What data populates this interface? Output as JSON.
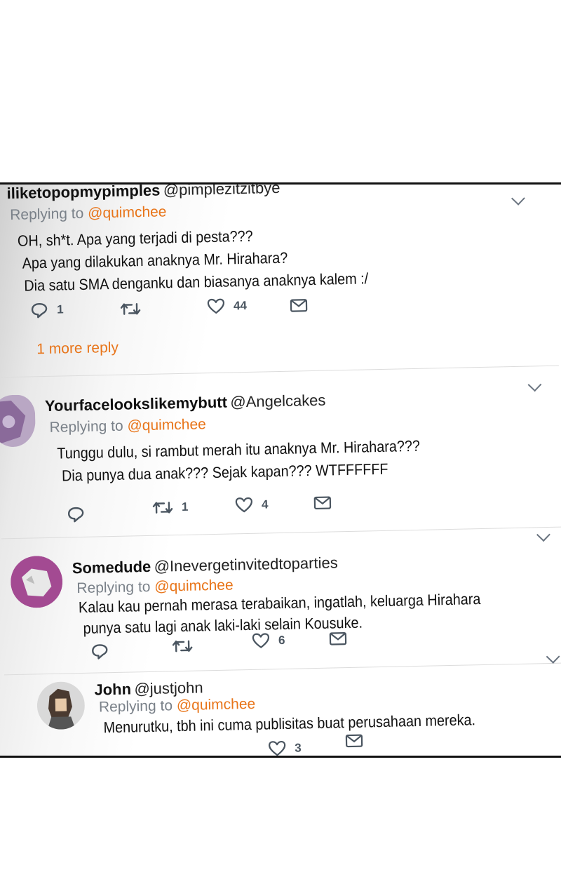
{
  "tweets": [
    {
      "name": "iliketopopmypimples",
      "handle": "@pimplezitzitbye",
      "replying_prefix": "Replying to",
      "replying_to": "@quimchee",
      "lines": [
        "OH, sh*t. Apa yang terjadi di pesta???",
        "Apa yang dilakukan anaknya Mr. Hirahara?",
        "Dia satu SMA denganku dan biasanya anaknya kalem :/"
      ],
      "replies": "1",
      "retweets": "",
      "likes": "44",
      "more_replies": "1 more reply"
    },
    {
      "name": "Yourfacelookslikemybutt",
      "handle": "@Angelcakes",
      "replying_prefix": "Replying to",
      "replying_to": "@quimchee",
      "lines": [
        "Tunggu dulu, si rambut merah itu anaknya Mr. Hirahara???",
        "Dia punya dua anak??? Sejak kapan??? WTFFFFFF"
      ],
      "replies": "",
      "retweets": "1",
      "likes": "4"
    },
    {
      "name": "Somedude",
      "handle": "@Inevergetinvitedtoparties",
      "replying_prefix": "Replying to",
      "replying_to": "@quimchee",
      "lines": [
        "Kalau kau pernah merasa terabaikan, ingatlah, keluarga Hirahara",
        "punya satu lagi anak laki-laki selain Kousuke."
      ],
      "replies": "",
      "retweets": "",
      "likes": "6"
    },
    {
      "name": "John",
      "handle": "@justjohn",
      "replying_prefix": "Replying to",
      "replying_to": "@quimchee",
      "lines": [
        "Menurutku, tbh ini cuma publisitas buat perusahaan mereka."
      ],
      "replies": "",
      "retweets": "",
      "likes": "3"
    }
  ],
  "icons": {
    "reply": "reply-icon",
    "retweet": "retweet-icon",
    "like": "heart-icon",
    "message": "envelope-icon",
    "menu": "chevron-down-icon"
  },
  "colors": {
    "accent": "#e8751a",
    "muted": "#7a8189",
    "icon": "#4a5560"
  }
}
